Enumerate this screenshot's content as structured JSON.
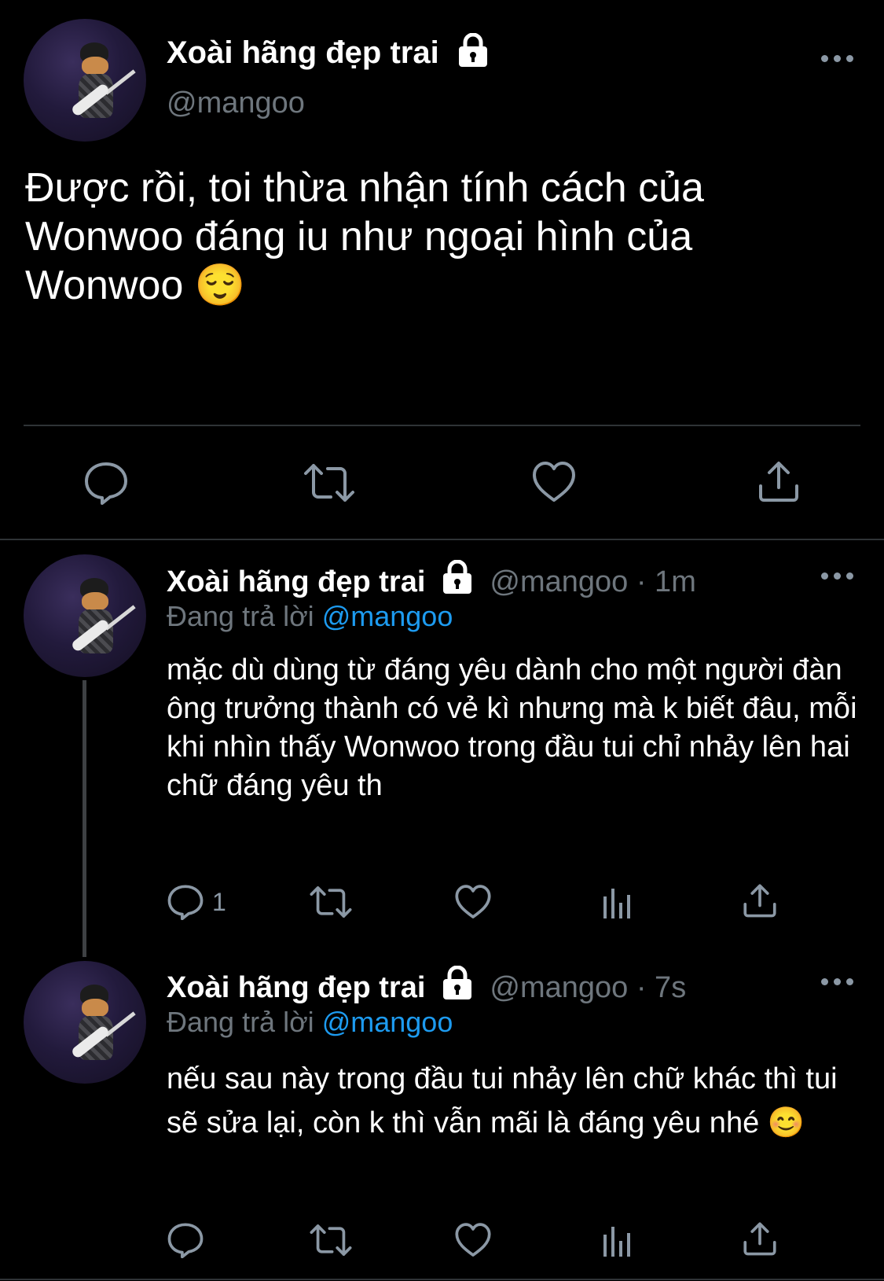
{
  "main_tweet": {
    "display_name": "Xoài hãng đẹp trai",
    "handle": "@mangoo",
    "text": "Được rồi, toi thừa nhận tính cách của Wonwoo đáng iu như ngoại hình của Wonwoo 😌",
    "actions": [
      "reply-icon",
      "retweet-icon",
      "like-icon",
      "share-icon"
    ]
  },
  "replies": [
    {
      "display_name": "Xoài hãng đẹp trai",
      "meta": "@mangoo · 1m",
      "replying_prefix": "Đang trả lời",
      "replying_to": "@mangoo",
      "text": "mặc dù dùng từ đáng yêu dành  cho một người đàn ông trưởng thành có vẻ kì nhưng mà k biết đâu, mỗi khi nhìn thấy Wonwoo trong đầu tui chỉ nhảy lên hai chữ đáng yêu th",
      "reply_count": "1"
    },
    {
      "display_name": "Xoài hãng đẹp trai",
      "meta": "@mangoo · 7s",
      "replying_prefix": "Đang trả lời",
      "replying_to": "@mangoo",
      "text": "nếu sau này trong đầu tui nhảy lên chữ khác thì tui sẽ sửa lại, còn k thì vẫn mãi là đáng yêu nhé 😊",
      "reply_count": ""
    }
  ],
  "colors": {
    "background": "#000000",
    "secondary_text": "#6e767d",
    "link": "#1d9bf0",
    "divider": "#2f3336",
    "icon": "#8b98a5"
  }
}
